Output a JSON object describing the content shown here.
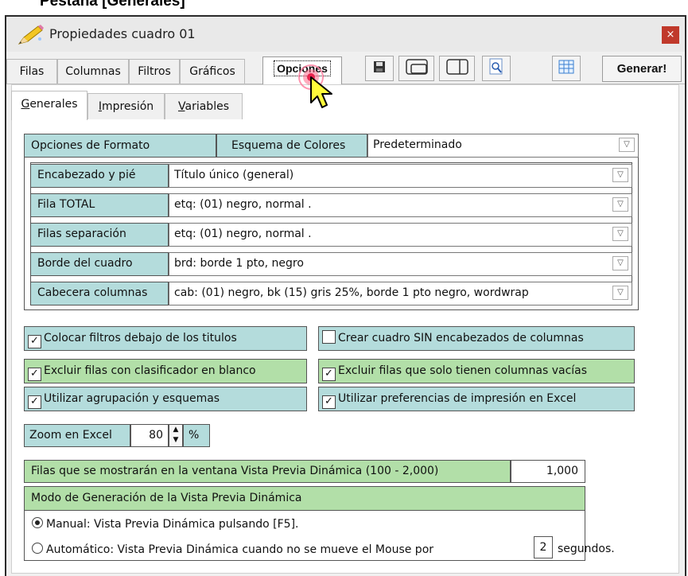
{
  "page_heading": "Pestaña [Generales]",
  "window": {
    "title": "Propiedades cuadro 01",
    "close_label": "×"
  },
  "tabs": [
    "Filas",
    "Columnas",
    "Filtros",
    "Gráficos",
    "Opciones"
  ],
  "active_tab": "Opciones",
  "toolbar": {
    "generate_label": "Generar!",
    "icons": [
      "save-icon",
      "layout-panel-icon",
      "split-view-icon",
      "preview-zoom-icon",
      "grid-table-icon"
    ]
  },
  "subtabs": [
    {
      "prefix": "",
      "hot": "G",
      "rest": "enerales"
    },
    {
      "prefix": "",
      "hot": "I",
      "rest": "mpresión"
    },
    {
      "prefix": "",
      "hot": "V",
      "rest": "ariables"
    }
  ],
  "format": {
    "section_label": "Opciones de Formato",
    "scheme_label": "Esquema de Colores",
    "scheme_value": "Predeterminado",
    "rows": [
      {
        "label": "Encabezado y pié",
        "value": "Título único (general)"
      },
      {
        "label": "Fila TOTAL",
        "value": "etq: (01) negro,  normal ."
      },
      {
        "label": "Filas separación",
        "value": "etq: (01) negro,  normal ."
      },
      {
        "label": "Borde del cuadro",
        "value": "brd: borde 1 pto, negro"
      },
      {
        "label": "Cabecera columnas",
        "value": "cab: (01) negro, bk (15) gris 25%, borde 1 pto negro, wordwrap"
      }
    ]
  },
  "checkboxes": [
    {
      "label": "Colocar filtros debajo de los titulos",
      "checked": true
    },
    {
      "label": "Crear cuadro SIN encabezados de columnas",
      "checked": false
    },
    {
      "label": "Excluir filas con clasificador en blanco",
      "checked": true
    },
    {
      "label": "Excluir filas que solo tienen columnas vacías",
      "checked": true
    },
    {
      "label": "Utilizar agrupación y esquemas",
      "checked": true
    },
    {
      "label": "Utilizar preferencias de impresión en Excel",
      "checked": true
    }
  ],
  "zoom": {
    "label": "Zoom en Excel",
    "value": "80",
    "unit": "%"
  },
  "preview_rows": {
    "label": "Filas que se mostrarán en la ventana Vista Previa Dinámica (100 - 2,000)",
    "value": "1,000"
  },
  "preview_mode": {
    "title": "Modo de Generación de la Vista Previa Dinámica",
    "manual_label": "Manual: Vista Previa Dinámica pulsando [F5].",
    "auto_label_before": "Automático: Vista Previa Dinámica cuando no se mueve el Mouse por",
    "auto_seconds": "2",
    "auto_label_after": "segundos.",
    "selected": "manual"
  },
  "colors": {
    "teal": "#b4dcdc",
    "green": "#b2dfa8",
    "close": "#c0392b"
  }
}
